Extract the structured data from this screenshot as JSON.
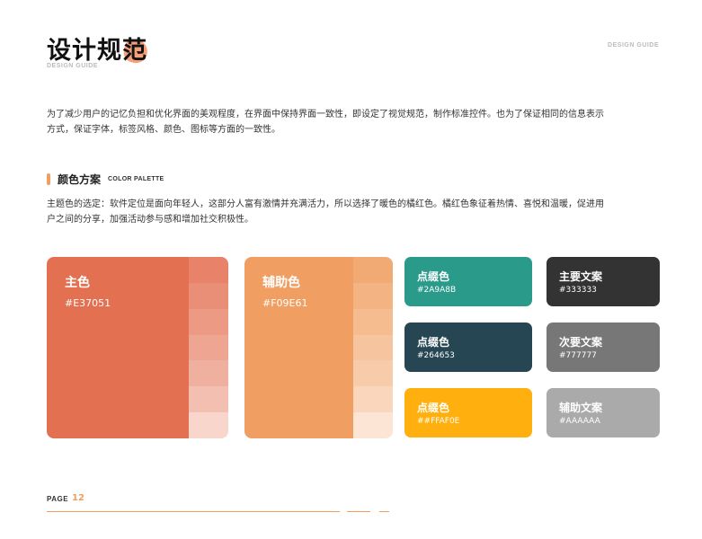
{
  "header": {
    "title": "设计规范",
    "subtitle": "DESIGN GUIDE",
    "corner_label": "DESIGN GUIDE"
  },
  "intro": "为了减少用户的记忆负担和优化界面的美观程度，在界面中保持界面一致性，即设定了视觉规范，制作标准控件。也为了保证相同的信息表示方式，保证字体，标签风格、颜色、图标等方面的一致性。",
  "section": {
    "title": "颜色方案",
    "title_en": "COLOR PALETTE",
    "description": "主题色的选定：软件定位是面向年轻人，这部分人富有激情并充满活力，所以选择了暖色的橘红色。橘红色象征着热情、喜悦和温暖，促进用户之间的分享，加强活动参与感和增加社交积极性。"
  },
  "palette": {
    "primary": {
      "name": "主色",
      "hex": "#E37051",
      "color": "#E37051",
      "tints": [
        "#E8836A",
        "#EA8F77",
        "#EC9A84",
        "#EEA592",
        "#F0B0A0",
        "#F3BFB1",
        "#F8D6CC"
      ]
    },
    "secondary": {
      "name": "辅助色",
      "hex": "#F09E61",
      "color": "#F09E61",
      "tints": [
        "#F2AA75",
        "#F3B382",
        "#F5BC90",
        "#F6C49E",
        "#F7CCAB",
        "#F9D6BC",
        "#FCE5D5"
      ]
    },
    "accents": [
      {
        "name": "点缀色",
        "hex": "#2A9A8B",
        "color": "#2A9A8B"
      },
      {
        "name": "点缀色",
        "hex": "#264653",
        "color": "#264653"
      },
      {
        "name": "点缀色",
        "hex": "##FFAF0E",
        "color": "#FFAF0E"
      }
    ],
    "text_colors": [
      {
        "name": "主要文案",
        "hex": "#333333",
        "color": "#333333"
      },
      {
        "name": "次要文案",
        "hex": "#777777",
        "color": "#777777"
      },
      {
        "name": "辅助文案",
        "hex": "#AAAAAA",
        "color": "#AAAAAA"
      }
    ]
  },
  "footer": {
    "page_label": "PAGE",
    "page_number": "12",
    "accent_color": "#F09E61"
  }
}
